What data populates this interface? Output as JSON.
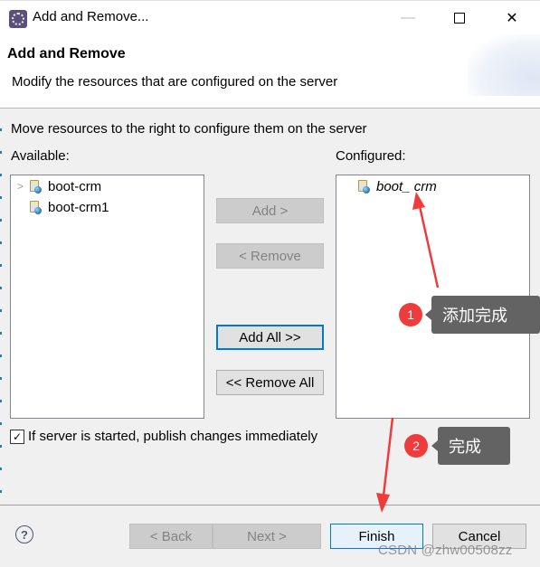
{
  "window": {
    "title": "Add and Remove...",
    "controls": {
      "minimize": "—",
      "maximize": "",
      "close": "✕"
    }
  },
  "header": {
    "title": "Add and Remove",
    "description": "Modify the resources that are configured on the server"
  },
  "instruction": "Move resources to the right to configure them on the server",
  "available": {
    "label": "Available:",
    "items": [
      {
        "label": "boot-crm",
        "expandable": true
      },
      {
        "label": "boot-crm1",
        "expandable": false
      }
    ]
  },
  "configured": {
    "label": "Configured:",
    "items": [
      {
        "label": "boot_ crm"
      }
    ]
  },
  "buttons": {
    "add": "Add >",
    "remove": "< Remove",
    "add_all": "Add All >>",
    "remove_all": "<< Remove All"
  },
  "publish_checkbox": {
    "label": "If server is started, publish changes immediately",
    "checked": true,
    "glyph": "✓"
  },
  "footer": {
    "help": "?",
    "back": "< Back",
    "next": "Next >",
    "finish": "Finish",
    "cancel": "Cancel"
  },
  "annotations": [
    {
      "number": "1",
      "text": "添加完成"
    },
    {
      "number": "2",
      "text": "完成"
    }
  ],
  "watermark": "CSDN @zhw00508zz",
  "colors": {
    "accent": "#0078d7",
    "annotation_red": "#ef3b3b",
    "annotation_bubble": "#636363"
  }
}
